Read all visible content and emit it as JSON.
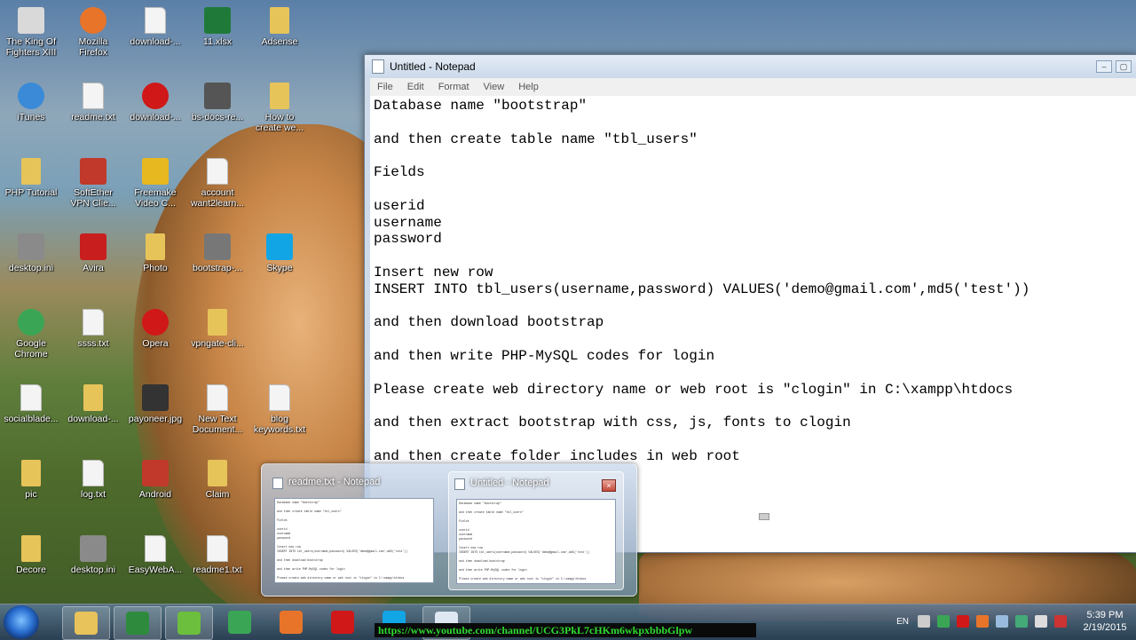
{
  "desktop": {
    "icons": [
      {
        "label": "The King Of\nFighters XIII",
        "kind": "app",
        "color": "#d9d9d9"
      },
      {
        "label": "Mozilla\nFirefox",
        "kind": "round",
        "color": "#e8742a"
      },
      {
        "label": "download-...",
        "kind": "doc",
        "color": "#f4f4f4"
      },
      {
        "label": "11.xlsx",
        "kind": "app",
        "color": "#1f7a3a"
      },
      {
        "label": "Adsense",
        "kind": "folder",
        "color": "#e6c45a"
      },
      {
        "label": "iTunes",
        "kind": "round",
        "color": "#3a8ad8"
      },
      {
        "label": "readme.txt",
        "kind": "doc",
        "color": "#f4f4f4"
      },
      {
        "label": "download-...",
        "kind": "round",
        "color": "#d01818"
      },
      {
        "label": "bs-docs-re...",
        "kind": "app",
        "color": "#555555"
      },
      {
        "label": "How to\ncreate we...",
        "kind": "folder",
        "color": "#e6c45a"
      },
      {
        "label": "PHP Tutorial",
        "kind": "folder",
        "color": "#e6c45a"
      },
      {
        "label": "SoftEther\nVPN Clie...",
        "kind": "app",
        "color": "#c0392b"
      },
      {
        "label": "Freemake\nVideo C...",
        "kind": "app",
        "color": "#e8b820"
      },
      {
        "label": "account\nwant2learn...",
        "kind": "doc",
        "color": "#f4f4f4"
      },
      {
        "label": "desktop.ini",
        "kind": "app",
        "color": "#8a8a8a"
      },
      {
        "label": "Avira",
        "kind": "app",
        "color": "#c81e1e"
      },
      {
        "label": "Photo",
        "kind": "folder",
        "color": "#e6c45a"
      },
      {
        "label": "bootstrap-...",
        "kind": "app",
        "color": "#777777"
      },
      {
        "label": "Skype",
        "kind": "app",
        "color": "#12a5e6"
      },
      {
        "label": "Google\nChrome",
        "kind": "round",
        "color": "#3aa655"
      },
      {
        "label": "ssss.txt",
        "kind": "doc",
        "color": "#f4f4f4"
      },
      {
        "label": "Opera",
        "kind": "round",
        "color": "#d01818"
      },
      {
        "label": "vpngate-cli...",
        "kind": "folder",
        "color": "#e6c45a"
      },
      {
        "label": "socialblade...",
        "kind": "doc",
        "color": "#f4f4f4"
      },
      {
        "label": "download-...",
        "kind": "folder",
        "color": "#e6c45a"
      },
      {
        "label": "payoneer.jpg",
        "kind": "app",
        "color": "#333333"
      },
      {
        "label": "New Text\nDocument...",
        "kind": "doc",
        "color": "#f4f4f4"
      },
      {
        "label": "blog\nkeywords.txt",
        "kind": "doc",
        "color": "#f4f4f4"
      },
      {
        "label": "pic",
        "kind": "folder",
        "color": "#e6c45a"
      },
      {
        "label": "log.txt",
        "kind": "doc",
        "color": "#f4f4f4"
      },
      {
        "label": "Android",
        "kind": "app",
        "color": "#c0392b"
      },
      {
        "label": "Claim",
        "kind": "folder",
        "color": "#e6c45a"
      },
      {
        "label": "Decore",
        "kind": "folder",
        "color": "#e6c45a"
      },
      {
        "label": "desktop.ini",
        "kind": "app",
        "color": "#8a8a8a"
      },
      {
        "label": "EasyWebA...",
        "kind": "doc",
        "color": "#f4f4f4"
      },
      {
        "label": "readme1.txt",
        "kind": "doc",
        "color": "#f4f4f4"
      }
    ]
  },
  "notepad": {
    "title": "Untitled - Notepad",
    "menu": [
      "File",
      "Edit",
      "Format",
      "View",
      "Help"
    ],
    "content": "Database name \"bootstrap\"\n\nand then create table name \"tbl_users\"\n\nFields\n\nuserid\nusername\npassword\n\nInsert new row\nINSERT INTO tbl_users(username,password) VALUES('demo@gmail.com',md5('test'))\n\nand then download bootstrap\n\nand then write PHP-MySQL codes for login\n\nPlease create web directory name or web root is \"clogin\" in C:\\xampp\\htdocs\n\nand then extract bootstrap with css, js, fonts to clogin\n\nand then create folder includes in web root"
  },
  "taskbar_preview": {
    "windows": [
      {
        "title": "readme.txt - Notepad",
        "active": false
      },
      {
        "title": "Untitled - Notepad",
        "active": true
      }
    ],
    "close_glyph": "×"
  },
  "taskbar": {
    "apps": [
      {
        "name": "explorer",
        "color": "#e8c25a",
        "active": true
      },
      {
        "name": "camtasia",
        "color": "#2e8b3e",
        "active": true
      },
      {
        "name": "maps",
        "color": "#6cbf3c",
        "active": true
      },
      {
        "name": "chrome",
        "color": "#3aa655",
        "active": false
      },
      {
        "name": "firefox",
        "color": "#e8742a",
        "active": false
      },
      {
        "name": "opera",
        "color": "#d01818",
        "active": false
      },
      {
        "name": "skype",
        "color": "#12a5e6",
        "active": false
      },
      {
        "name": "notepad",
        "color": "#dfe8f2",
        "active": true
      }
    ],
    "url_overlay": "https://www.youtube.com/channel/UCG3PkL7cHKm6wkpxbbbGlpw",
    "language": "EN",
    "time": "5:39 PM",
    "date": "2/19/2015"
  },
  "colors": {
    "notepad_frame": "#cfdbe9",
    "url_text": "#2fdb2f"
  }
}
